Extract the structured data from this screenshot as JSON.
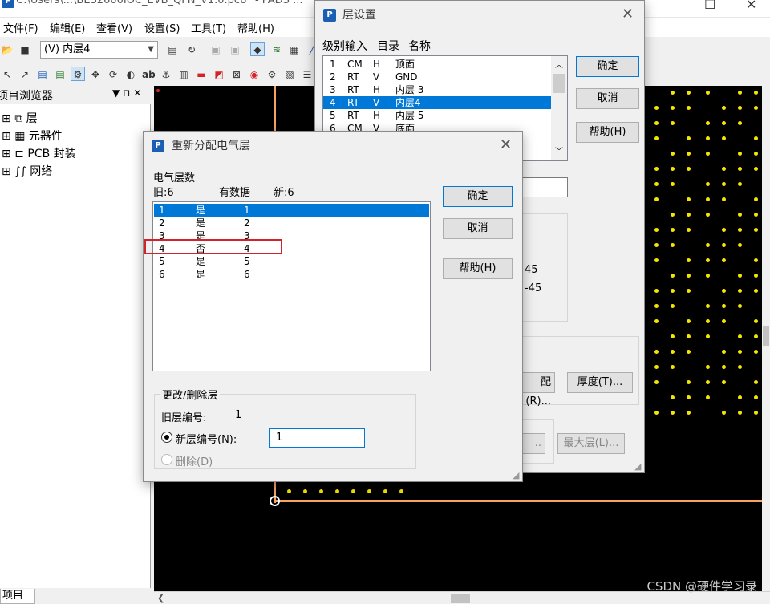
{
  "window": {
    "title": "C:\\Users\\...\\BES2600IOC_EVB_QFN_V1.0.pcb* - PADS ..."
  },
  "menu": [
    "文件(F)",
    "编辑(E)",
    "查看(V)",
    "设置(S)",
    "工具(T)",
    "帮助(H)"
  ],
  "toolbar": {
    "layer_combo": "(V) 内层4"
  },
  "project_browser": {
    "title": "项目浏览器",
    "pin_glyph": "▼ ⊓ ✕",
    "items": [
      {
        "label": "层",
        "icon": "layers-icon"
      },
      {
        "label": "元器件",
        "icon": "component-icon"
      },
      {
        "label": "PCB 封装",
        "icon": "footprint-icon"
      },
      {
        "label": "网络",
        "icon": "net-icon"
      }
    ],
    "bottom_tab": "项目"
  },
  "layer_dialog": {
    "title": "层设置",
    "header": [
      "级别输入",
      "目录",
      "名称"
    ],
    "rows": [
      {
        "level": "1",
        "type": "CM",
        "dir": "H",
        "name": "顶面"
      },
      {
        "level": "2",
        "type": "RT",
        "dir": "V",
        "name": "GND"
      },
      {
        "level": "3",
        "type": "RT",
        "dir": "H",
        "name": "内层 3"
      },
      {
        "level": "4",
        "type": "RT",
        "dir": "V",
        "name": "内层4"
      },
      {
        "level": "5",
        "type": "RT",
        "dir": "H",
        "name": "内层 5"
      },
      {
        "level": "6",
        "type": "CM",
        "dir": "V",
        "name": "底面"
      }
    ],
    "selected_index": 3,
    "ok": "确定",
    "cancel": "取消",
    "help": "帮助(H)",
    "angle1": "45",
    "angle2": "-45",
    "reassign_btn": "配(R)...",
    "thickness_btn": "厚度(T)...",
    "dots_btn": "..",
    "max_layers_btn": "最大层(L)..."
  },
  "reassign_dialog": {
    "title": "重新分配电气层",
    "count_label": "电气层数",
    "old_label": "旧:6",
    "has_data_label": "有数据",
    "new_label": "新:6",
    "rows": [
      {
        "old": "1",
        "has_data": "是",
        "new": "1"
      },
      {
        "old": "2",
        "has_data": "是",
        "new": "2"
      },
      {
        "old": "3",
        "has_data": "是",
        "new": "3"
      },
      {
        "old": "4",
        "has_data": "否",
        "new": "4"
      },
      {
        "old": "5",
        "has_data": "是",
        "new": "5"
      },
      {
        "old": "6",
        "has_data": "是",
        "new": "6"
      }
    ],
    "ok": "确定",
    "cancel": "取消",
    "help": "帮助(H)",
    "group_title": "更改/删除层",
    "old_layer_label": "旧层编号:",
    "old_layer_value": "1",
    "new_layer_label": "新层编号(N):",
    "new_layer_value": "1",
    "delete_label": "删除(D)"
  },
  "watermark": "CSDN @硬件学习录"
}
